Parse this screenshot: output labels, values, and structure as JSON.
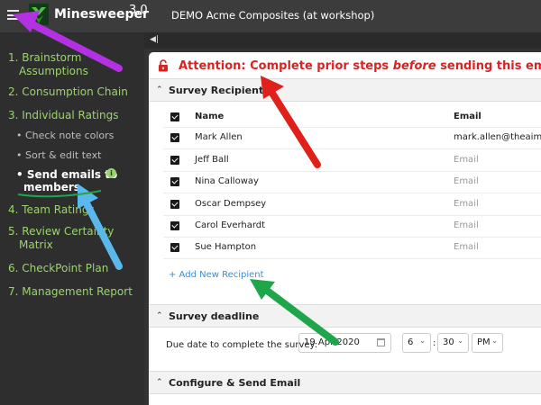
{
  "app": {
    "title": "Minesweeper",
    "version": "3.0",
    "workspace": "DEMO Acme Composites (at workshop)"
  },
  "sidebar": {
    "items": [
      {
        "label_line1": "1. Brainstorm",
        "label_line2": "Assumptions"
      },
      {
        "label": "2. Consumption Chain"
      },
      {
        "label": "3. Individual Ratings"
      },
      {
        "label": "4. Team Ratings"
      },
      {
        "label_line1": "5. Review Certainty",
        "label_line2": "Matrix"
      },
      {
        "label": "6. CheckPoint Plan"
      },
      {
        "label": "7. Management Report"
      }
    ],
    "subitems": [
      {
        "label": "• Check note colors"
      },
      {
        "label": "• Sort & edit text"
      },
      {
        "label_line1": "• Send emails to",
        "label_line2": "members",
        "active": true
      }
    ]
  },
  "attention": {
    "prefix": "Attention: Complete prior steps ",
    "emphasis": "before",
    "suffix": " sending this email"
  },
  "recipients": {
    "section_title": "Survey Recipients",
    "columns": {
      "name": "Name",
      "email": "Email"
    },
    "rows": [
      {
        "name": "Mark Allen",
        "email": "mark.allen@theaiminst"
      },
      {
        "name": "Jeff Ball",
        "email": "Email"
      },
      {
        "name": "Nina Calloway",
        "email": "Email"
      },
      {
        "name": "Oscar Dempsey",
        "email": "Email"
      },
      {
        "name": "Carol Everhardt",
        "email": "Email"
      },
      {
        "name": "Sue Hampton",
        "email": "Email"
      }
    ],
    "add_label": "+ Add New Recipient"
  },
  "deadline": {
    "section_title": "Survey deadline",
    "due_label": "Due date to complete the survey:",
    "date": "19 Apr 2020",
    "hour": "6",
    "minute": "30",
    "ampm": "PM"
  },
  "configure": {
    "section_title": "Configure & Send Email"
  },
  "colors": {
    "accent_green": "#9bd46e",
    "attention_red": "#d82323",
    "link_blue": "#3a8fd6",
    "arrow_purple": "#b431e3",
    "arrow_red": "#e0201a",
    "arrow_blue": "#5bb8ec",
    "arrow_green": "#1fa64a"
  }
}
